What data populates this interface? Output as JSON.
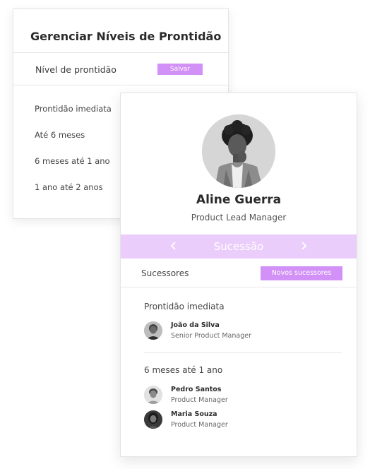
{
  "readiness_panel": {
    "title": "Gerenciar Níveis de Prontidão",
    "level_label": "Nível de prontidão",
    "save_label": "Salvar",
    "levels": [
      "Prontidão imediata",
      "Até 6 meses",
      "6 meses até 1 ano",
      "1 ano até 2 anos"
    ]
  },
  "profile": {
    "name": "Aline Guerra",
    "role": "Product Lead Manager",
    "avatar_icon": "person-photo-avatar"
  },
  "succession": {
    "title": "Sucessão",
    "prev_icon": "chevron-left-icon",
    "next_icon": "chevron-right-icon",
    "successors_label": "Sucessores",
    "new_successors_label": "Novos sucessores",
    "groups": [
      {
        "title": "Prontidão imediata",
        "people": [
          {
            "name": "João da Silva",
            "role": "Senior Product Manager"
          }
        ]
      },
      {
        "title": "6 meses até 1 ano",
        "people": [
          {
            "name": "Pedro Santos",
            "role": "Product Manager"
          },
          {
            "name": "Maria Souza",
            "role": "Product Manager"
          }
        ]
      }
    ]
  },
  "colors": {
    "accent": "#d291f6",
    "accent_light": "#ebcdfb"
  }
}
